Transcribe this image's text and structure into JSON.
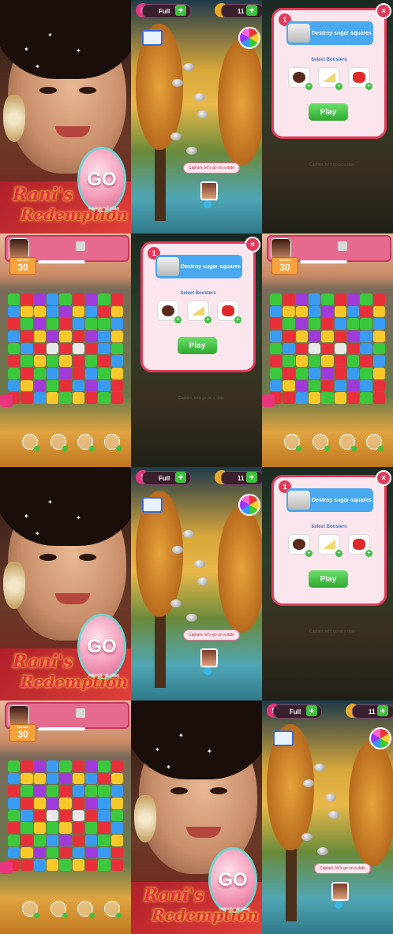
{
  "portrait": {
    "go_label": "GO",
    "go_note": "watch ad play",
    "title_line1": "Rani's",
    "title_line2": "Redemption"
  },
  "map": {
    "lives_count": "5",
    "lives_status": "Full",
    "coins_count": "11",
    "bubble_text": "Captain, let's go on a date"
  },
  "booster_dialog": {
    "level_number": "1",
    "goal_text": "Destroy sugar squares",
    "select_label": "Select Boosters",
    "play_label": "Play",
    "close_label": "×",
    "boosters": [
      "chocolate-cake-icon",
      "cake-slice-icon",
      "red-gummy-icon"
    ],
    "background_text": "Captain, let's go on a date"
  },
  "puzzle": {
    "moves_label": "MOVES",
    "moves_value": "30",
    "tools": [
      "bomb-tool-icon",
      "hand-tool-icon",
      "cookie-tool-icon",
      "swap-tool-icon"
    ],
    "colors": {
      "green": "#3cc83c",
      "red": "#e8303a",
      "blue": "#3a9cf0",
      "yellow": "#f7c82a",
      "purple": "#a03ad8",
      "white": "#e8e8e8"
    },
    "board": [
      [
        "green",
        "red",
        "purple",
        "blue",
        "green",
        "red",
        "purple",
        "green",
        "red"
      ],
      [
        "blue",
        "yellow",
        "yellow",
        "blue",
        "purple",
        "yellow",
        "blue",
        "red",
        "yellow"
      ],
      [
        "red",
        "green",
        "purple",
        "green",
        "red",
        "blue",
        "green",
        "green",
        "blue"
      ],
      [
        "blue",
        "red",
        "yellow",
        "purple",
        "yellow",
        "red",
        "purple",
        "blue",
        "yellow"
      ],
      [
        "green",
        "blue",
        "red",
        "white",
        "red",
        "white",
        "red",
        "blue",
        "green"
      ],
      [
        "red",
        "green",
        "yellow",
        "green",
        "yellow",
        "red",
        "green",
        "red",
        "blue"
      ],
      [
        "green",
        "red",
        "green",
        "blue",
        "purple",
        "red",
        "blue",
        "green",
        "yellow"
      ],
      [
        "blue",
        "yellow",
        "purple",
        "green",
        "red",
        "blue",
        "purple",
        "blue",
        "red"
      ],
      [
        "red",
        "red",
        "blue",
        "yellow",
        "green",
        "yellow",
        "red",
        "green",
        "red"
      ]
    ]
  }
}
